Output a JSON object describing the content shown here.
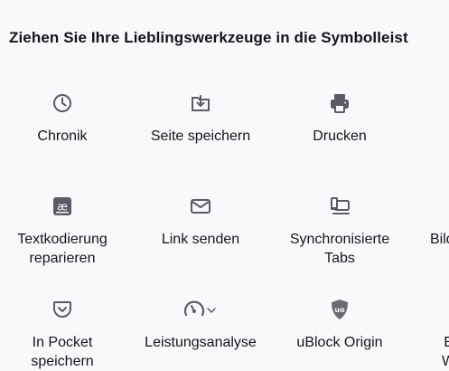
{
  "palette": {
    "heading": "Ziehen Sie Ihre Lieblingswerkzeuge in die Symbolleist",
    "items": [
      {
        "label": "Chronik",
        "icon": "clock-icon"
      },
      {
        "label": "Seite speichern",
        "icon": "save-page-icon"
      },
      {
        "label": "Drucken",
        "icon": "printer-icon"
      },
      {
        "label_lines": [
          "Textkodierung",
          "reparieren"
        ],
        "icon": "text-encoding-icon"
      },
      {
        "label": "Link senden",
        "icon": "mail-icon"
      },
      {
        "label_lines": [
          "Synchronisierte",
          "Tabs"
        ],
        "icon": "synced-tabs-icon"
      },
      {
        "label": "Bild",
        "icon": ""
      },
      {
        "label_lines": [
          "In Pocket",
          "speichern"
        ],
        "icon": "pocket-icon"
      },
      {
        "label": "Leistungsanalyse",
        "icon": "performance-gauge-icon"
      },
      {
        "label": "uBlock Origin",
        "icon": "ublock-origin-icon"
      },
      {
        "label_lines": [
          "E",
          "W"
        ],
        "icon": ""
      }
    ]
  },
  "colors": {
    "background": "#f9f9fb",
    "text": "#15141a",
    "icon": "#5b5b66"
  }
}
